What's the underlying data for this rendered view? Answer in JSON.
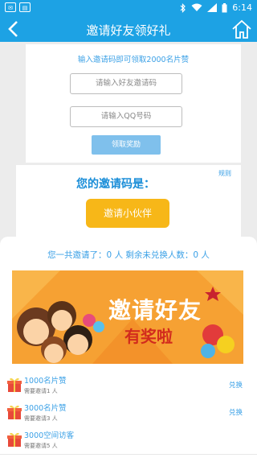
{
  "statusbar": {
    "time": "6:14",
    "app_icon_1": "app-icon",
    "app_icon_2": "app-icon"
  },
  "header": {
    "title": "邀请好友领好礼",
    "back_icon": "chevron-left-icon",
    "home_icon": "home-icon"
  },
  "redeem_form": {
    "hint": "输入邀请码即可领取2000名片赞",
    "invite_code_placeholder": "请输入好友邀请码",
    "qq_placeholder": "请输入QQ号码",
    "claim_label": "领取奖励"
  },
  "my_code": {
    "rule_label": "规则",
    "label": "您的邀请码是：",
    "invite_button": "邀请小伙伴"
  },
  "summary": "您一共邀请了：0 人  剩余未兑换人数：0 人",
  "banner": {
    "line1": "邀请好友",
    "line2": "有奖啦"
  },
  "rewards": [
    {
      "name": "1000名片赞",
      "need": "需要邀请1 人",
      "action": "兑换"
    },
    {
      "name": "3000名片赞",
      "need": "需要邀请3 人",
      "action": "兑换"
    },
    {
      "name": "3000空间访客",
      "need": "需要邀请5 人",
      "action": ""
    }
  ],
  "colors": {
    "primary": "#1da2e4",
    "accent_text": "#3aa0e6",
    "invite_button": "#f7b718",
    "banner_bg": "#f6a133"
  }
}
